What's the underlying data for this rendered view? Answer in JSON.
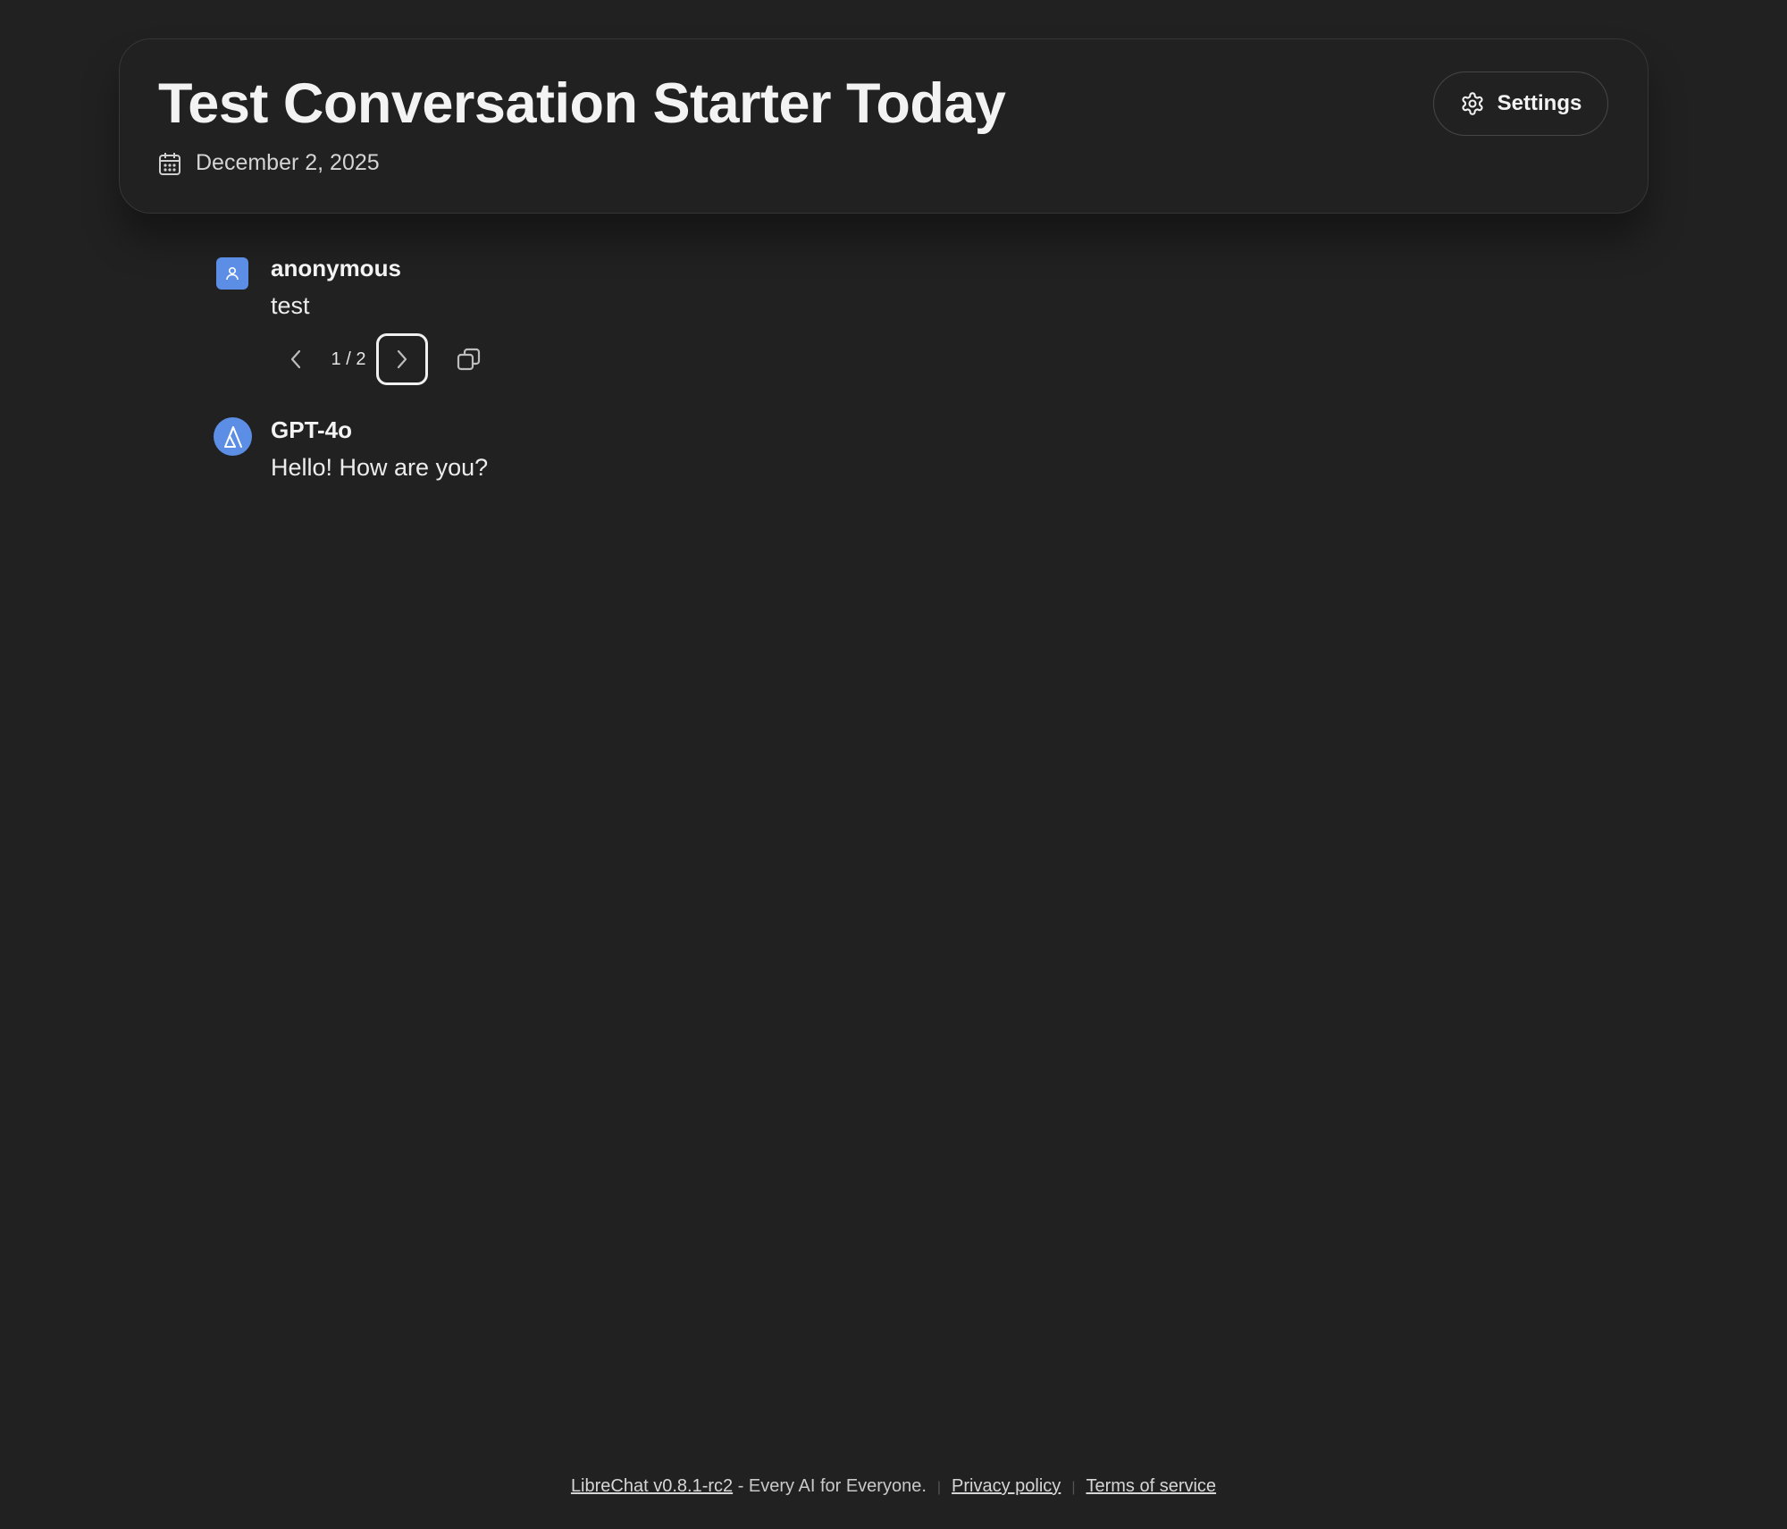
{
  "header": {
    "title": "Test Conversation Starter Today",
    "date": "December 2, 2025",
    "settings_label": "Settings",
    "calendar_icon": "calendar-icon",
    "settings_icon": "gear-icon"
  },
  "messages": [
    {
      "sender": "anonymous",
      "text": "test",
      "avatar_icon": "user-icon",
      "sibling_nav": {
        "current": 1,
        "total": 2,
        "display": "1 / 2",
        "prev_icon": "chevron-left-icon",
        "next_icon": "chevron-right-icon"
      },
      "copy_icon": "copy-icon"
    },
    {
      "sender": "GPT-4o",
      "text": "Hello! How are you?",
      "avatar_icon": "model-logo-icon"
    }
  ],
  "footer": {
    "version_link": "LibreChat v0.8.1-rc2",
    "tagline": " - Every AI for Everyone.",
    "privacy_link": "Privacy policy",
    "terms_link": "Terms of service"
  },
  "colors": {
    "background": "#212121",
    "card_border": "#363636",
    "avatar_accent": "#5c8ee6",
    "text_primary": "#f3f3f3"
  }
}
